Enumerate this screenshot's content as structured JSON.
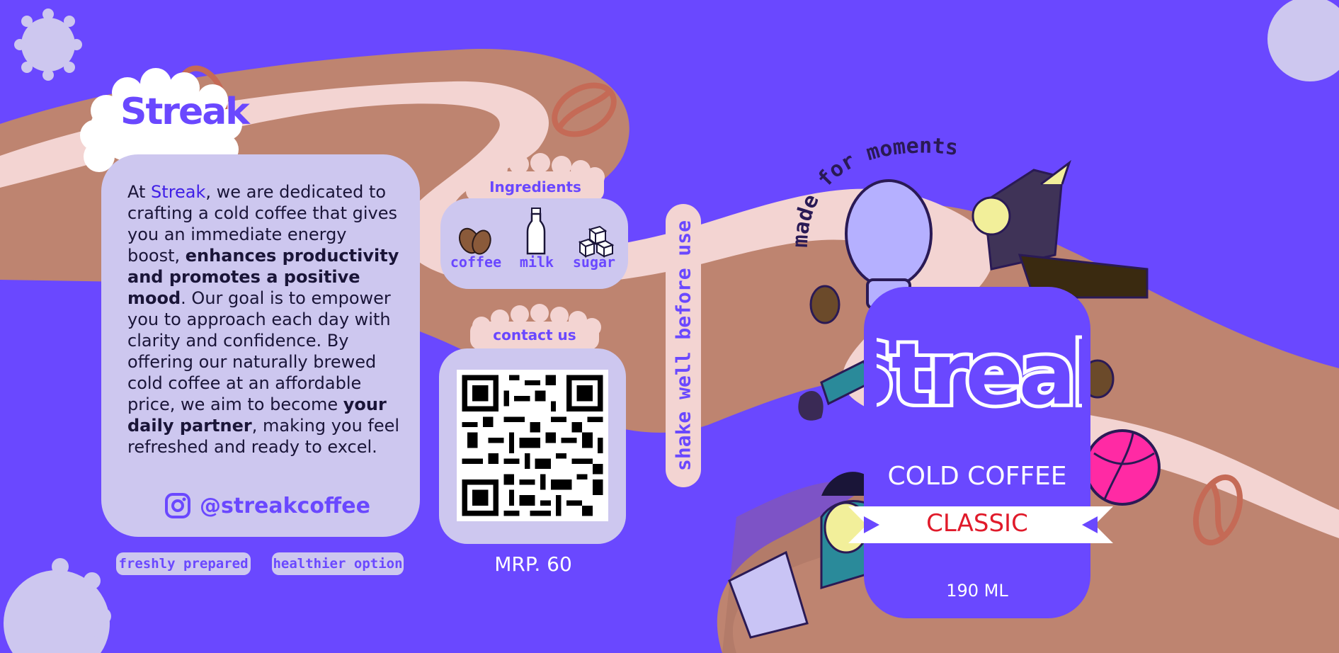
{
  "brand": {
    "logo_text": "Streak",
    "logo_big_text": "Streak"
  },
  "mission": {
    "p1": "At ",
    "brand_word": "Streak",
    "p2": ", we are dedicated to crafting a cold coffee that gives you an immediate energy boost, ",
    "bold1": "enhances productivity and promotes a positive mood",
    "p3": ". Our goal is to empower you to approach each day with clarity and confidence. By offering our naturally brewed cold coffee at an affordable price, we aim to become ",
    "bold2": "your daily partner",
    "p4": ", making you feel refreshed and ready to excel."
  },
  "social": {
    "instagram_handle": "@streakcoffee",
    "icon": "instagram-icon"
  },
  "badges": {
    "fresh": "freshly prepared",
    "healthy": "healthier option"
  },
  "ingredients": {
    "title": "Ingredients",
    "items": [
      {
        "label": "coffee",
        "icon": "coffee-bean-icon"
      },
      {
        "label": "milk",
        "icon": "milk-bottle-icon"
      },
      {
        "label": "sugar",
        "icon": "sugar-cubes-icon"
      }
    ]
  },
  "contact": {
    "title": "contact us",
    "qr_icon": "qr-code-icon"
  },
  "price": "MRP. 60",
  "shake_note": "shake well before use",
  "tagline": "made for moments",
  "product": {
    "name": "COLD COFFEE",
    "variant": "CLASSIC",
    "volume": "190 ML"
  },
  "colors": {
    "background": "#6a48ff",
    "panel": "#cdc7ef",
    "swirl_brown": "#be8470",
    "swirl_pink": "#f3d4d2",
    "accent_red": "#e01a2a"
  }
}
